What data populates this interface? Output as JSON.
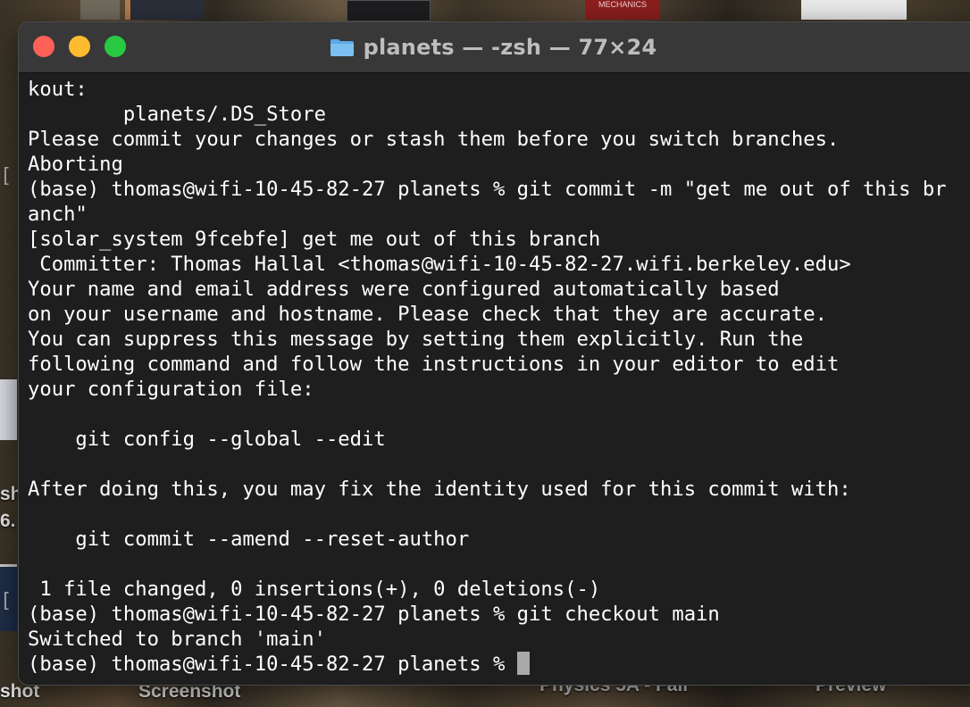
{
  "desktop": {
    "thumb_text": "MECHANICS",
    "labels": {
      "shot_left": "shot",
      "screenshot": "Screenshot",
      "physics": "Physics 5A - Fall",
      "preview": "Preview",
      "sh": "sh",
      "six": "6."
    }
  },
  "window": {
    "title": "planets — -zsh — 77×24",
    "folder_icon": "folder-icon",
    "buttons": {
      "close": "close-icon",
      "minimize": "minimize-icon",
      "maximize": "maximize-icon"
    },
    "colors": {
      "close": "#fe5f57",
      "minimize": "#febc2e",
      "maximize": "#28c840",
      "background": "#1e1e1e"
    }
  },
  "terminal": {
    "lines": [
      "kout:",
      "        planets/.DS_Store",
      "Please commit your changes or stash them before you switch branches.",
      "Aborting",
      "(base) thomas@wifi-10-45-82-27 planets % git commit -m \"get me out of this br",
      "anch\"",
      "[solar_system 9fcebfe] get me out of this branch",
      " Committer: Thomas Hallal <thomas@wifi-10-45-82-27.wifi.berkeley.edu>",
      "Your name and email address were configured automatically based",
      "on your username and hostname. Please check that they are accurate.",
      "You can suppress this message by setting them explicitly. Run the",
      "following command and follow the instructions in your editor to edit",
      "your configuration file:",
      "",
      "    git config --global --edit",
      "",
      "After doing this, you may fix the identity used for this commit with:",
      "",
      "    git commit --amend --reset-author",
      "",
      " 1 file changed, 0 insertions(+), 0 deletions(-)",
      "(base) thomas@wifi-10-45-82-27 planets % git checkout main",
      "Switched to branch 'main'",
      "(base) thomas@wifi-10-45-82-27 planets % "
    ],
    "prompt_marker": "["
  }
}
